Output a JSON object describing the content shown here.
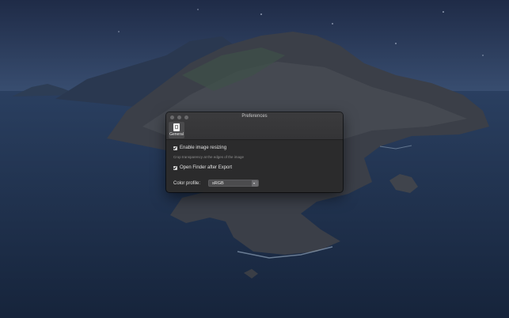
{
  "window": {
    "title": "Preferences",
    "tabs": [
      {
        "label": "General",
        "icon": "document-icon"
      }
    ]
  },
  "settings": {
    "enable_resizing": {
      "label": "Enable image resizing",
      "checked": true
    },
    "crop_hint": "Crop transparency at the edges of the image",
    "open_finder": {
      "label": "Open Finder after Export",
      "checked": true
    },
    "color_profile": {
      "label": "Color profile:",
      "value": "sRGB"
    }
  },
  "colors": {
    "window_bg": "#2b2b2c",
    "toolbar_bg": "#38383a",
    "wallpaper_sky": "#243456",
    "wallpaper_sea": "#1a2b45"
  }
}
